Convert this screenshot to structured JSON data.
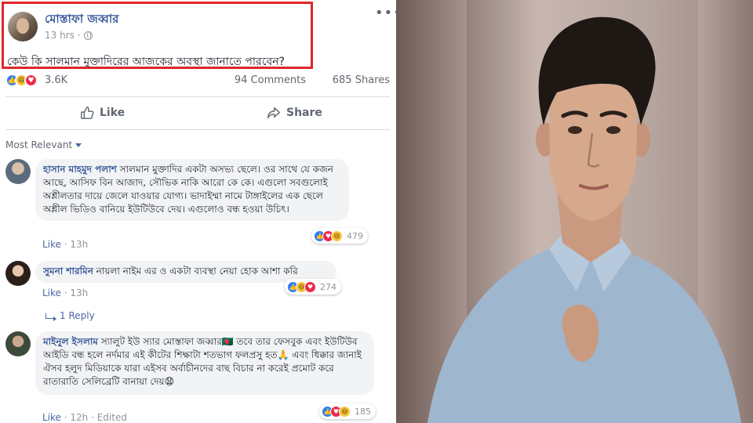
{
  "post": {
    "author": "মোস্তাফা জব্বার",
    "time": "13 hrs",
    "text": "কেউ কি সালমান মুক্তাদিরের আজকের অবস্থা জানাতে পারবেন?",
    "more_label": "•••"
  },
  "stats": {
    "reactions": "3.6K",
    "comments": "94 Comments",
    "shares": "685 Shares"
  },
  "actions": {
    "like": "Like",
    "share": "Share"
  },
  "sort_label": "Most Relevant",
  "comments": [
    {
      "name": "হাসান মাহমুদ পলাশ",
      "text": " সালমান মুক্তাদির একটা অসভ্য ছেলে। ওর সাথে যে কজন আছে, আসিফ বিন আজাদ, সৌভিক নাকি আরো কে কে। এগুলো সবগুলোই অশ্লীলতার দায়ে জেলে যাওয়ার যোগ্য। ভাদাইম্মা নামে টাঙ্গাইলের এক ছেলে অশ্লীল ভিডিও বানিয়ে ইউটিউবে দেয়। এগুলোও বন্ধ হওয়া উচিৎ।",
      "like_label": "Like",
      "time": "13h",
      "reaction_count": "479",
      "edited": ""
    },
    {
      "name": "সুমনা শারমিন",
      "text": " নায়লা নাইম এর ও একটা ব্যবস্থা নেয়া হোক আশা করি",
      "like_label": "Like",
      "time": "13h",
      "reaction_count": "274",
      "edited": ""
    },
    {
      "name": "মাইনুল ইসলাম",
      "text": " স্যালুট ইউ স্যার মোস্তাফা জব্বার🇧🇩 তবে তার ফেসবুক এবং ইউটিউব আইডি বন্ধ হলে নর্দমার এই কীটের শিক্ষাটা শতভাগ ফলপ্রসু হত🙏 এবং ধিক্কার জানাই ঐসব হলুদ মিডিয়াকে যারা এইসব অর্বাচীনদের বাছ বিচার না করেই প্রমোট করে রাতারাতি সেলিব্রেটি বানায়া দেয়😧",
      "like_label": "Like",
      "time": "12h",
      "reaction_count": "185",
      "edited": "Edited"
    }
  ],
  "reply": {
    "label": "1 Reply"
  },
  "colors": {
    "link_blue": "#385898",
    "highlight_red": "#e0262a",
    "like_blue": "#2d7ff9",
    "love_red": "#f0284a",
    "haha_yellow": "#f7c33a"
  }
}
